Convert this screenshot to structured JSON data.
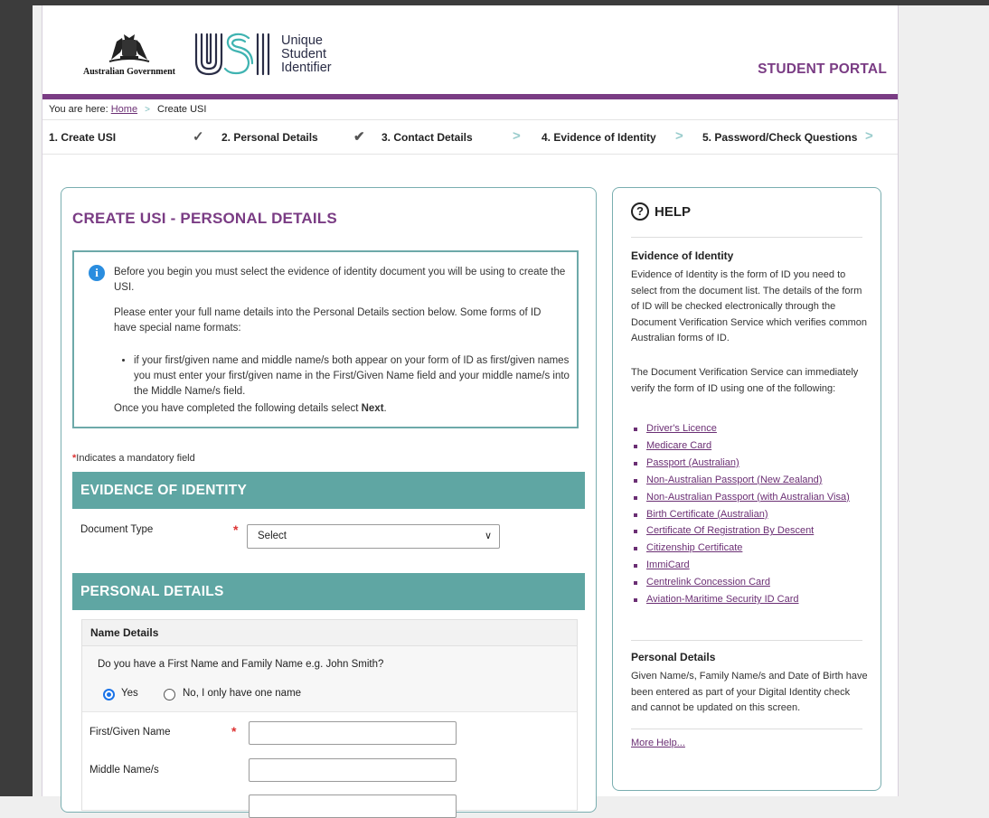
{
  "header": {
    "gov_name": "Australian Government",
    "usi_letters": "USI",
    "usi_lines": [
      "Unique",
      "Student",
      "Identifier"
    ],
    "portal_label": "STUDENT PORTAL"
  },
  "breadcrumb": {
    "prefix": "You are here:",
    "home": "Home",
    "current": "Create USI"
  },
  "steps": [
    {
      "label": "1. Create USI",
      "marker": "✓"
    },
    {
      "label": "2. Personal Details",
      "marker": "v"
    },
    {
      "label": "3. Contact Details",
      "marker": ">"
    },
    {
      "label": "4. Evidence of Identity",
      "marker": ">"
    },
    {
      "label": "5. Password/Check Questions",
      "marker": ">"
    }
  ],
  "main": {
    "title": "CREATE USI - PERSONAL DETAILS",
    "info": {
      "p1": "Before you begin you must select the evidence of identity document you will be using to create the USI.",
      "p2": "Please enter your full name details into the Personal Details section below. Some forms of ID have special name formats:",
      "bullet": "if your first/given name and middle name/s both appear on your form of ID as first/given names you must enter your first/given name in the First/Given Name field and your middle name/s into the Middle Name/s field.",
      "p3_prefix": "Once you have completed the following details select ",
      "p3_bold": "Next",
      "p3_suffix": "."
    },
    "mandatory_note": "Indicates a mandatory field",
    "evidence_heading": "EVIDENCE OF IDENTITY",
    "document_type_label": "Document Type",
    "document_type_value": "Select",
    "personal_heading": "PERSONAL DETAILS",
    "name_details": {
      "heading": "Name Details",
      "question": "Do you have a First Name and Family Name e.g. John Smith?",
      "option_yes": "Yes",
      "option_no": "No, I only have one name",
      "selected": "Yes",
      "first_name_label": "First/Given Name",
      "middle_name_label": "Middle Name/s",
      "first_name_value": "",
      "middle_name_value": ""
    }
  },
  "help": {
    "title": "HELP",
    "eoi_heading": "Evidence of Identity",
    "eoi_p1": "Evidence of Identity is the form of ID you need to select from the document list. The details of the form of ID will be checked electronically through the Document Verification Service which verifies common Australian forms of ID.",
    "eoi_p2": "The Document Verification Service can immediately verify the form of ID using one of the following:",
    "documents": [
      "Driver's Licence",
      "Medicare Card",
      "Passport (Australian)",
      "Non-Australian Passport (New Zealand)",
      "Non-Australian Passport (with Australian Visa)",
      "Birth Certificate (Australian)",
      "Certificate Of Registration By Descent",
      "Citizenship Certificate",
      "ImmiCard",
      "Centrelink Concession Card",
      "Aviation-Maritime Security ID Card"
    ],
    "pd_heading": "Personal Details",
    "pd_p": "Given Name/s, Family Name/s and Date of Birth have been entered as part of your Digital Identity check and cannot be updated on this screen.",
    "more_help": "More Help..."
  },
  "colors": {
    "brand_purple": "#7a3c84",
    "section_teal": "#5fa6a3",
    "link_purple": "#6b2f74",
    "info_blue": "#2a8ddf",
    "required_red": "#d33333"
  }
}
